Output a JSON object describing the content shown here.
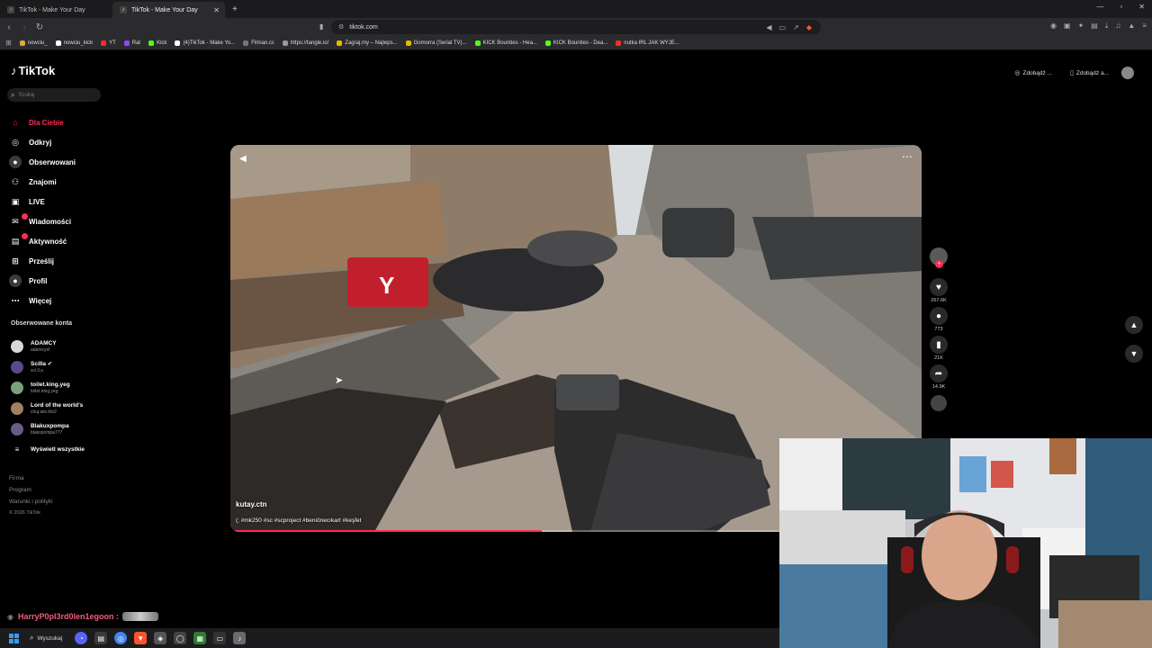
{
  "browser": {
    "tabs": [
      {
        "title": "TikTok - Make Your Day",
        "active": false
      },
      {
        "title": "TikTok - Make Your Day",
        "active": true
      }
    ],
    "new_tab_icon": "plus-icon",
    "url": "tiktok.com",
    "bookmarks": [
      {
        "label": "nowciu_",
        "color": "#e0a83a"
      },
      {
        "label": "nowciu_kick",
        "color": "#ffffff"
      },
      {
        "label": "YT",
        "color": "#ff2a2a"
      },
      {
        "label": "Rat",
        "color": "#9146ff"
      },
      {
        "label": "Kick",
        "color": "#53fc18"
      },
      {
        "label": "(4)TikTok - Make Yo...",
        "color": "#ffffff"
      },
      {
        "label": "Filman.cc",
        "color": "#777777"
      },
      {
        "label": "https://tangle.io/",
        "color": "#999999"
      },
      {
        "label": "Zagraj.my – Najleps...",
        "color": "#e6b800"
      },
      {
        "label": "Gomorra (Serial TV)...",
        "color": "#e6b800"
      },
      {
        "label": "KICK Bounties - Hea...",
        "color": "#53fc18"
      },
      {
        "label": "KICK Bounties - Dea...",
        "color": "#53fc18"
      },
      {
        "label": "nutka IRL JAK WYJE...",
        "color": "#ff2a2a"
      }
    ]
  },
  "tiktok": {
    "logo_text": "TikTok",
    "search_placeholder": "Szukaj",
    "nav": [
      {
        "label": "Dla Ciebie",
        "icon": "home-icon",
        "active": true
      },
      {
        "label": "Odkryj",
        "icon": "compass-icon",
        "active": false
      },
      {
        "label": "Obserwowani",
        "icon": "avatar-icon",
        "active": false
      },
      {
        "label": "Znajomi",
        "icon": "friends-icon",
        "active": false
      },
      {
        "label": "LIVE",
        "icon": "live-icon",
        "active": false
      },
      {
        "label": "Wiadomości",
        "icon": "messages-icon",
        "active": false
      },
      {
        "label": "Aktywność",
        "icon": "activity-icon",
        "active": false
      },
      {
        "label": "Prześlij",
        "icon": "upload-icon",
        "active": false
      },
      {
        "label": "Profil",
        "icon": "profile-icon",
        "active": false
      },
      {
        "label": "Więcej",
        "icon": "more-icon",
        "active": false
      }
    ],
    "following_title": "Obserwowane konta",
    "following": [
      {
        "name": "ADAMCY",
        "handle": "adamcyxl",
        "color": "#d9d9d9"
      },
      {
        "name": "Scilla ✔",
        "handle": "sci.ll.a",
        "color": "#5b4a8a"
      },
      {
        "name": "toilet.king.yeg",
        "handle": "toilet.king.yeg",
        "color": "#7aa07a"
      },
      {
        "name": "Lord of the world's",
        "handle": "chuj.wie.kto2",
        "color": "#a08060"
      },
      {
        "name": "Blakuxpompa",
        "handle": "blakxpompa777",
        "color": "#6a5a8a"
      }
    ],
    "see_all": "Wyświetl wszystkie",
    "footer": [
      "Firma",
      "Program",
      "Warunki i polityki"
    ],
    "copyright": "© 2026 TikTok",
    "top_buttons": [
      "Zdobądź ...",
      "Zdobądź a..."
    ]
  },
  "video": {
    "author": "kutay.ctn",
    "caption": "(; #mk250 #sc #scproject #beniönecıkart #keşfet",
    "progress": 0.45,
    "actions": [
      {
        "icon": "heart-icon",
        "count": "267.6K"
      },
      {
        "icon": "comment-icon",
        "count": "773"
      },
      {
        "icon": "bookmark-icon",
        "count": "21K"
      },
      {
        "icon": "share-icon",
        "count": "14.9K"
      }
    ]
  },
  "stream": {
    "chat_user": "HarryP0pl3rd0len1egoon :"
  },
  "taskbar": {
    "search_label": "Wyszukaj"
  }
}
